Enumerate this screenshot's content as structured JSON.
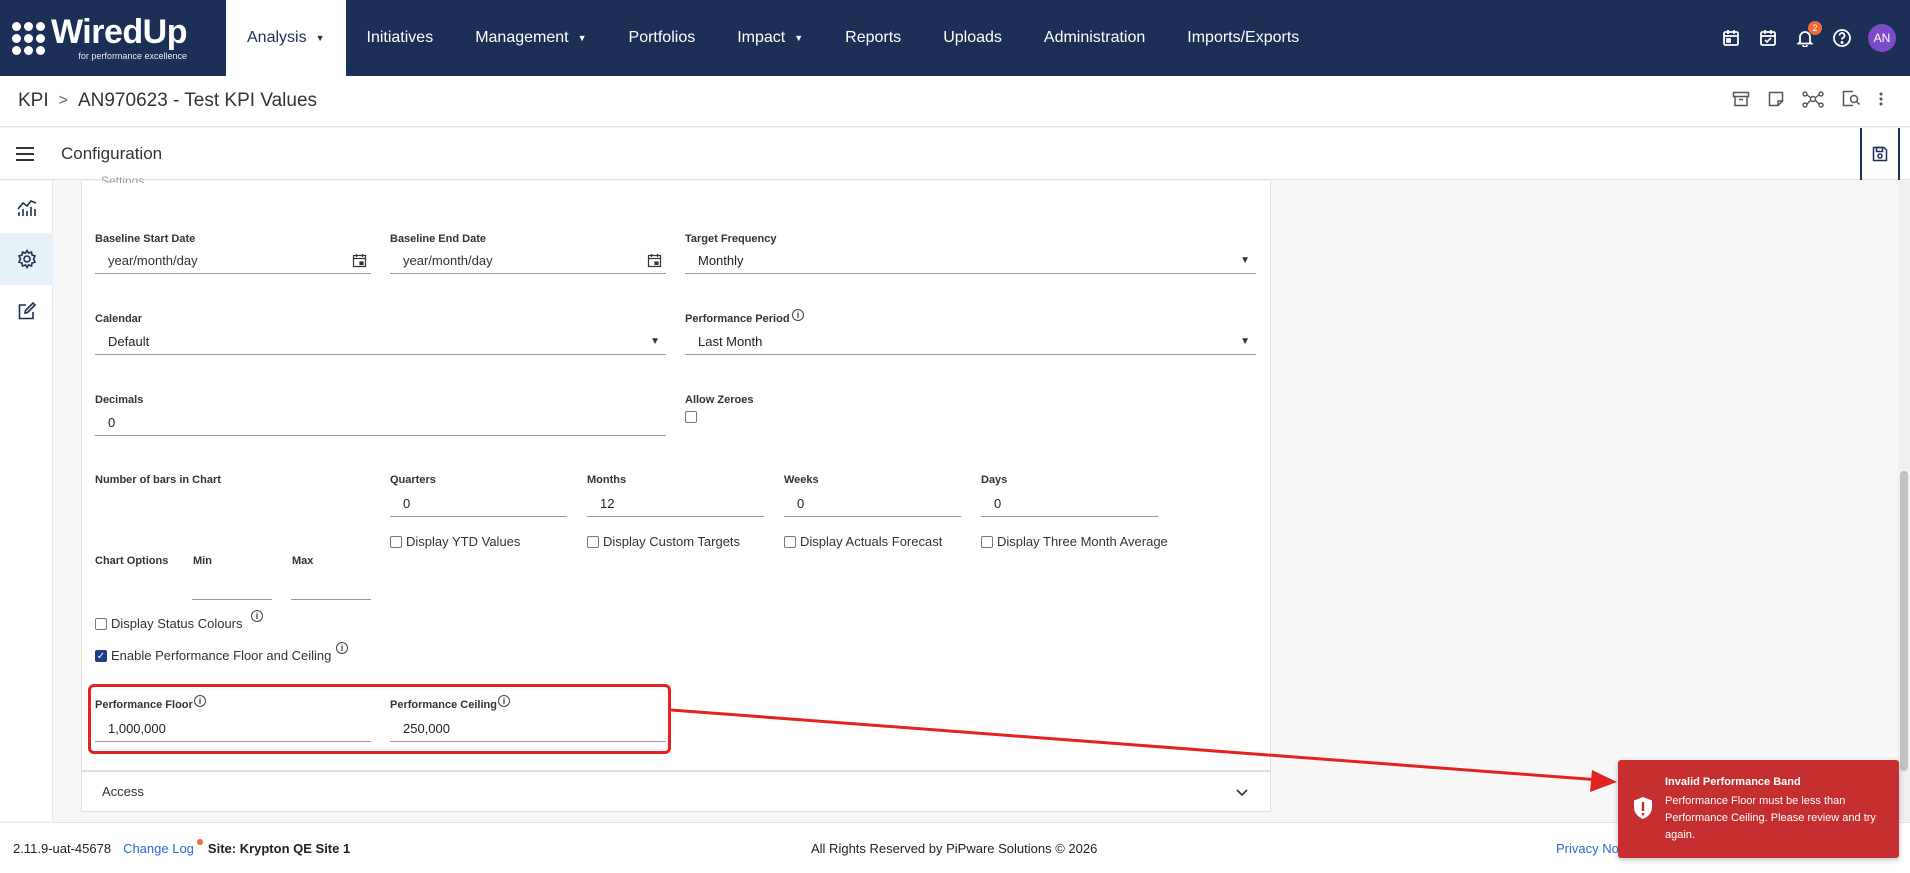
{
  "nav": {
    "brand_name": "WiredUp",
    "brand_tagline": "for performance excellence",
    "items": [
      {
        "label": "Analysis",
        "has_caret": true
      },
      {
        "label": "Initiatives"
      },
      {
        "label": "Management",
        "has_caret": true
      },
      {
        "label": "Portfolios"
      },
      {
        "label": "Impact",
        "has_caret": true
      },
      {
        "label": "Reports"
      },
      {
        "label": "Uploads"
      },
      {
        "label": "Administration"
      },
      {
        "label": "Imports/Exports"
      }
    ],
    "active": "Analysis",
    "notification_count": "2",
    "avatar_initials": "AN",
    "colors": {
      "bar": "#1c2f56",
      "avatar": "#7b4bc8",
      "badge": "#ef6a3d"
    },
    "icons": [
      "calendar-icon",
      "calendar-check-icon",
      "bell-icon",
      "help-icon"
    ]
  },
  "breadcrumb": {
    "root": "KPI",
    "current": "AN970623 - Test KPI Values",
    "actions": [
      "archive-icon",
      "note-icon",
      "network-icon",
      "search-document-icon",
      "more-vertical-icon"
    ]
  },
  "config_bar": {
    "title": "Configuration"
  },
  "rail": {
    "items": [
      "chart-icon",
      "gear-icon",
      "edit-icon"
    ],
    "active": "gear-icon"
  },
  "form": {
    "section_legend": "Settings",
    "baseline_start": {
      "label": "Baseline Start Date",
      "placeholder": "year/month/day"
    },
    "baseline_end": {
      "label": "Baseline End Date",
      "placeholder": "year/month/day"
    },
    "target_frequency": {
      "label": "Target Frequency",
      "value": "Monthly"
    },
    "calendar": {
      "label": "Calendar",
      "value": "Default"
    },
    "performance_period": {
      "label": "Performance Period",
      "value": "Last Month"
    },
    "decimals": {
      "label": "Decimals",
      "value": "0"
    },
    "allow_zeroes": {
      "label": "Allow Zeroes",
      "checked": false
    },
    "bars": {
      "label": "Number of bars in Chart",
      "quarters": {
        "label": "Quarters",
        "value": "0"
      },
      "months": {
        "label": "Months",
        "value": "12"
      },
      "weeks": {
        "label": "Weeks",
        "value": "0"
      },
      "days": {
        "label": "Days",
        "value": "0"
      }
    },
    "display_ytd": {
      "label": "Display YTD Values",
      "checked": false
    },
    "display_custom_targets": {
      "label": "Display Custom Targets",
      "checked": false
    },
    "display_actuals_forecast": {
      "label": "Display Actuals Forecast",
      "checked": false
    },
    "display_three_month": {
      "label": "Display Three Month Average",
      "checked": false
    },
    "chart_options": {
      "label": "Chart Options",
      "min_label": "Min",
      "max_label": "Max",
      "min": "",
      "max": ""
    },
    "display_status_colours": {
      "label": "Display Status Colours",
      "checked": false
    },
    "enable_floor_ceiling": {
      "label": "Enable Performance Floor and Ceiling",
      "checked": true
    },
    "performance_floor": {
      "label": "Performance Floor",
      "value": "1,000,000"
    },
    "performance_ceiling": {
      "label": "Performance Ceiling",
      "value": "250,000"
    },
    "highlight_color": "#e32222"
  },
  "access": {
    "label": "Access"
  },
  "footer": {
    "version": "2.11.9-uat-45678",
    "change_log": "Change Log",
    "site": "Site: Krypton QE Site 1",
    "rights": "All Rights Reserved by PiPware Solutions © 2026",
    "privacy": "Privacy No"
  },
  "toast": {
    "title": "Invalid Performance Band",
    "message": "Performance Floor must be less than Performance Ceiling. Please review and try again.",
    "color": "#c62f2f"
  }
}
